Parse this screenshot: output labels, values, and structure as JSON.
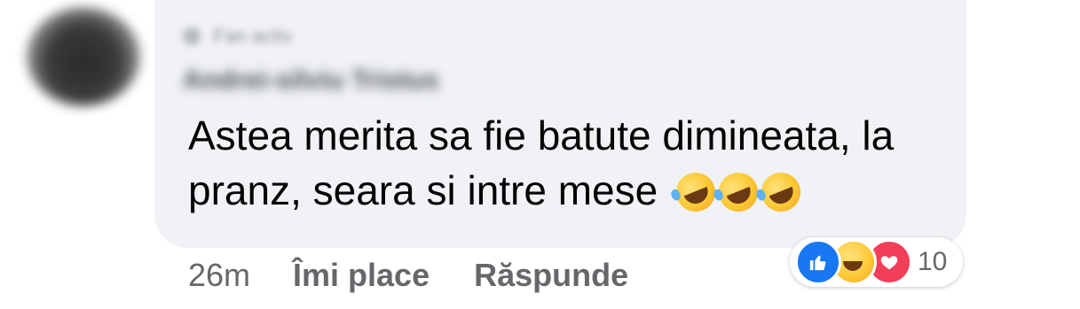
{
  "comment": {
    "header_meta": "Fan activ",
    "author": "Andrei-silviu Tristus",
    "text": "Astea merita sa fie batute dimineata, la pranz, seara si intre mese",
    "emojis": [
      "rolling-on-floor-laughing",
      "rolling-on-floor-laughing",
      "rolling-on-floor-laughing"
    ]
  },
  "actions": {
    "time": "26m",
    "like_label": "Îmi place",
    "reply_label": "Răspunde"
  },
  "reactions": {
    "types": [
      "like-icon",
      "haha-icon",
      "love-icon"
    ],
    "count": "10",
    "colors": {
      "like": "#1877f2",
      "haha": "#fcc733",
      "love": "#f33e58"
    }
  }
}
